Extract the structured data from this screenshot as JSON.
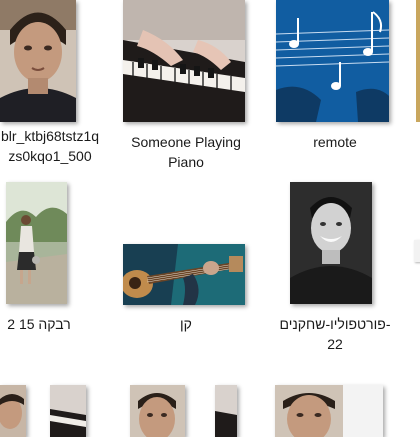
{
  "files": [
    {
      "label": "blr_ktbj68tstz1q\nzs0kqo1_500",
      "icon": "portrait-photo"
    },
    {
      "label": "Someone Playing\nPiano",
      "icon": "piano-photo"
    },
    {
      "label": "remote",
      "icon": "music-notes-photo"
    },
    {
      "label": "רבקה 15 2",
      "icon": "woman-walking-photo"
    },
    {
      "label": "קן",
      "icon": "guitar-photo"
    },
    {
      "label": "פורטפוליו-שחקנים-\n22",
      "icon": "smiling-man-photo"
    }
  ],
  "colors": {
    "selection": "#cce8ff",
    "label_text": "#1a1a1a"
  }
}
